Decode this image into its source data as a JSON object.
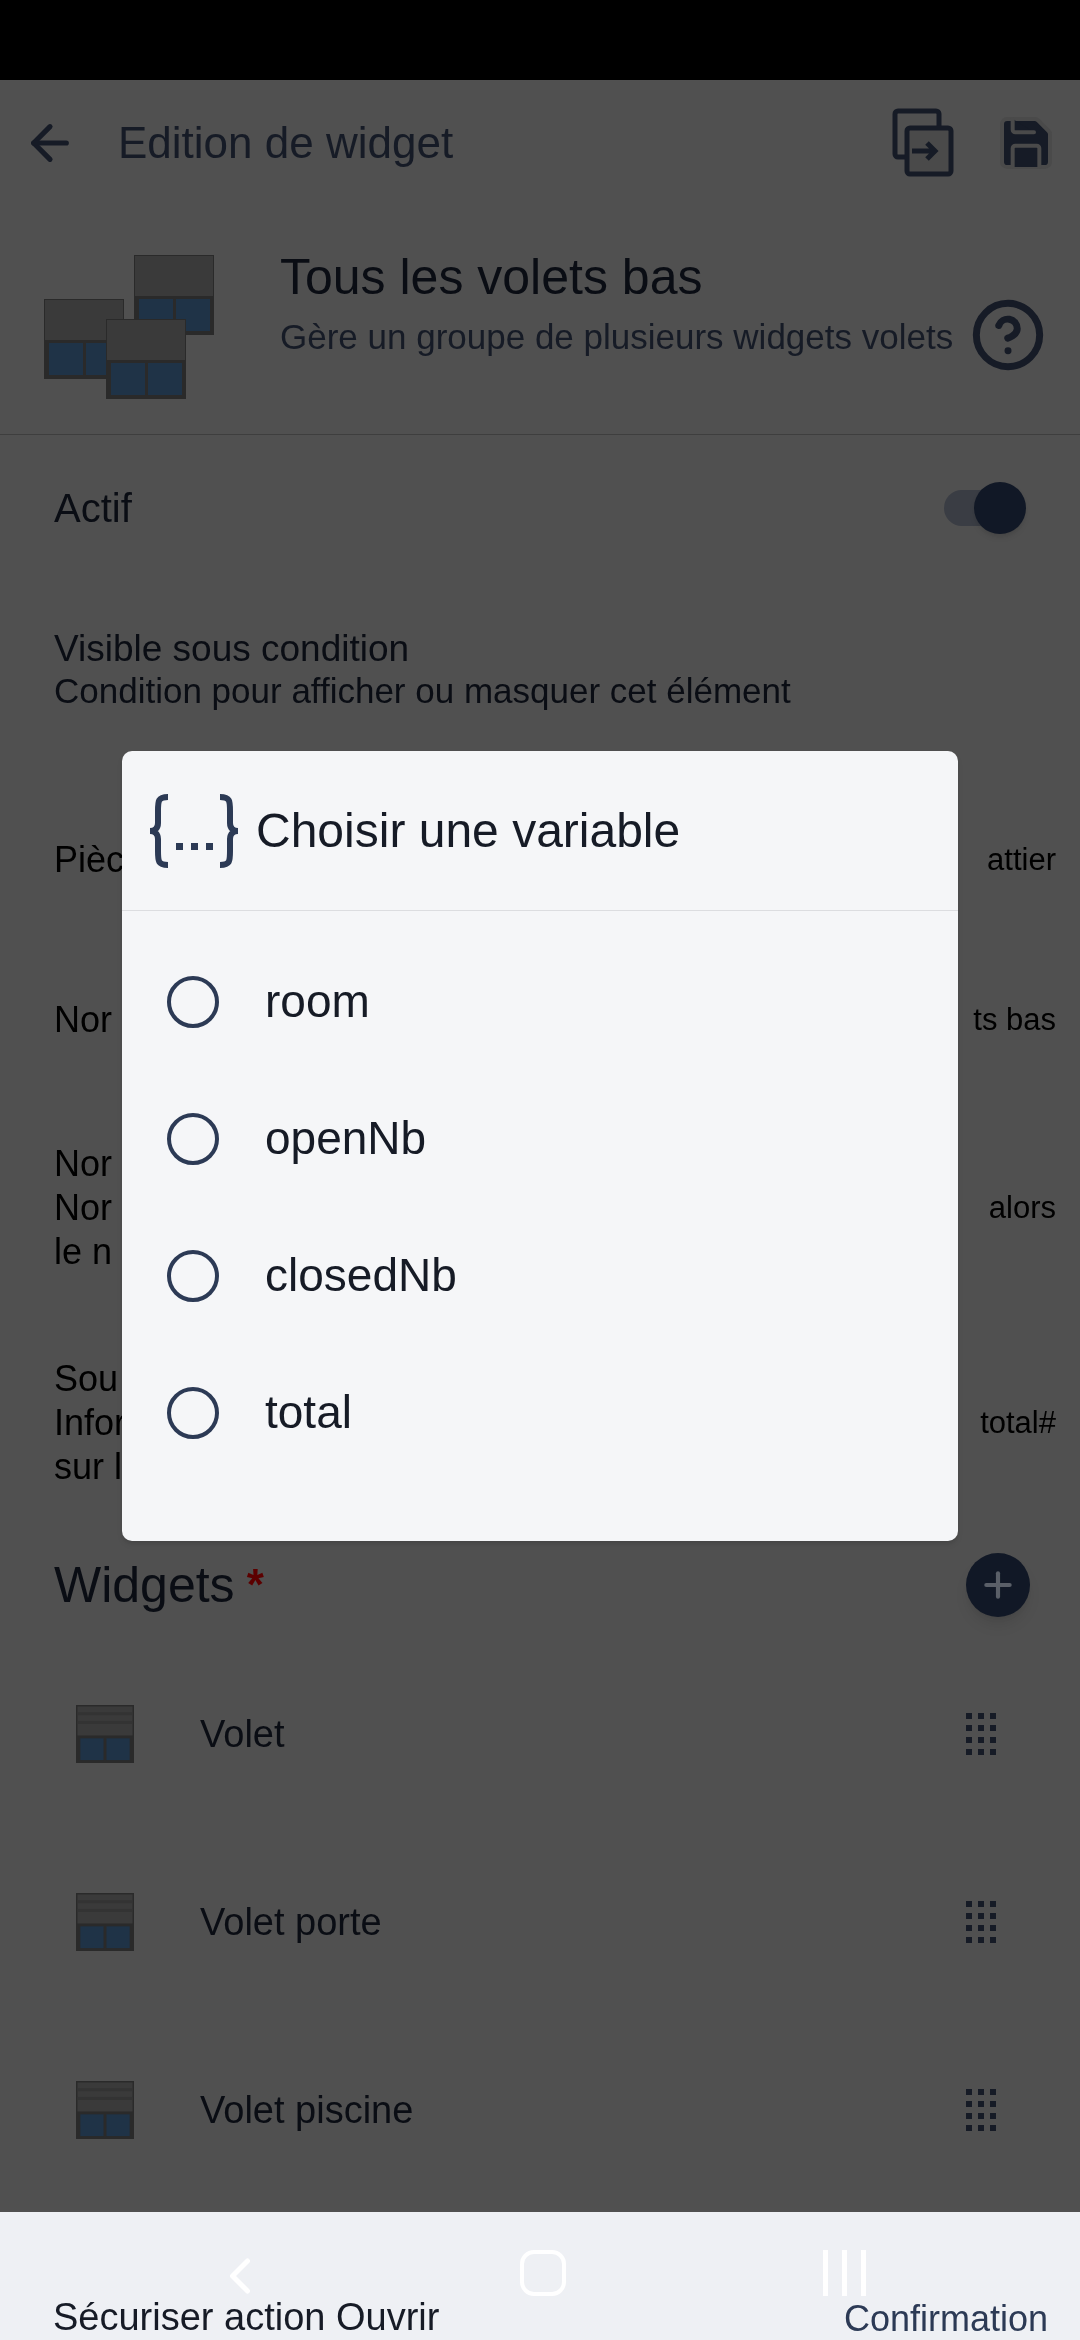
{
  "app_bar": {
    "title": "Edition de widget"
  },
  "widget_header": {
    "title": "Tous les volets bas",
    "description": "Gère un groupe de plusieurs widgets volets"
  },
  "settings": [
    {
      "kind": "toggle",
      "label": "Actif",
      "on": true
    },
    {
      "kind": "text",
      "title": "Visible sous condition",
      "subtitle": "Condition pour afficher ou masquer cet élément"
    },
    {
      "kind": "partial",
      "lines": [
        {
          "left": "Pièc",
          "right": "attier"
        }
      ]
    },
    {
      "kind": "partial",
      "lines": [
        {
          "left": "Nor",
          "right": "ts bas"
        }
      ]
    },
    {
      "kind": "partial",
      "lines": [
        {
          "left": "Nor"
        },
        {
          "left": "Nor",
          "right": "alors"
        },
        {
          "left": "le n"
        }
      ]
    },
    {
      "kind": "partial",
      "lines": [
        {
          "left": "Sou"
        },
        {
          "left": "Infor",
          "right": "total#"
        },
        {
          "left": "sur l"
        }
      ]
    }
  ],
  "widgets_section": {
    "title": "Widgets",
    "required_mark": "*"
  },
  "widgets": [
    {
      "name": "Volet"
    },
    {
      "name": "Volet porte"
    },
    {
      "name": "Volet piscine"
    }
  ],
  "dialog": {
    "title": "Choisir une variable",
    "options": [
      {
        "label": "room",
        "selected": false
      },
      {
        "label": "openNb",
        "selected": false
      },
      {
        "label": "closedNb",
        "selected": false
      },
      {
        "label": "total",
        "selected": false
      }
    ]
  },
  "bottom": {
    "left": "Sécuriser action Ouvrir",
    "right": "Confirmation"
  }
}
